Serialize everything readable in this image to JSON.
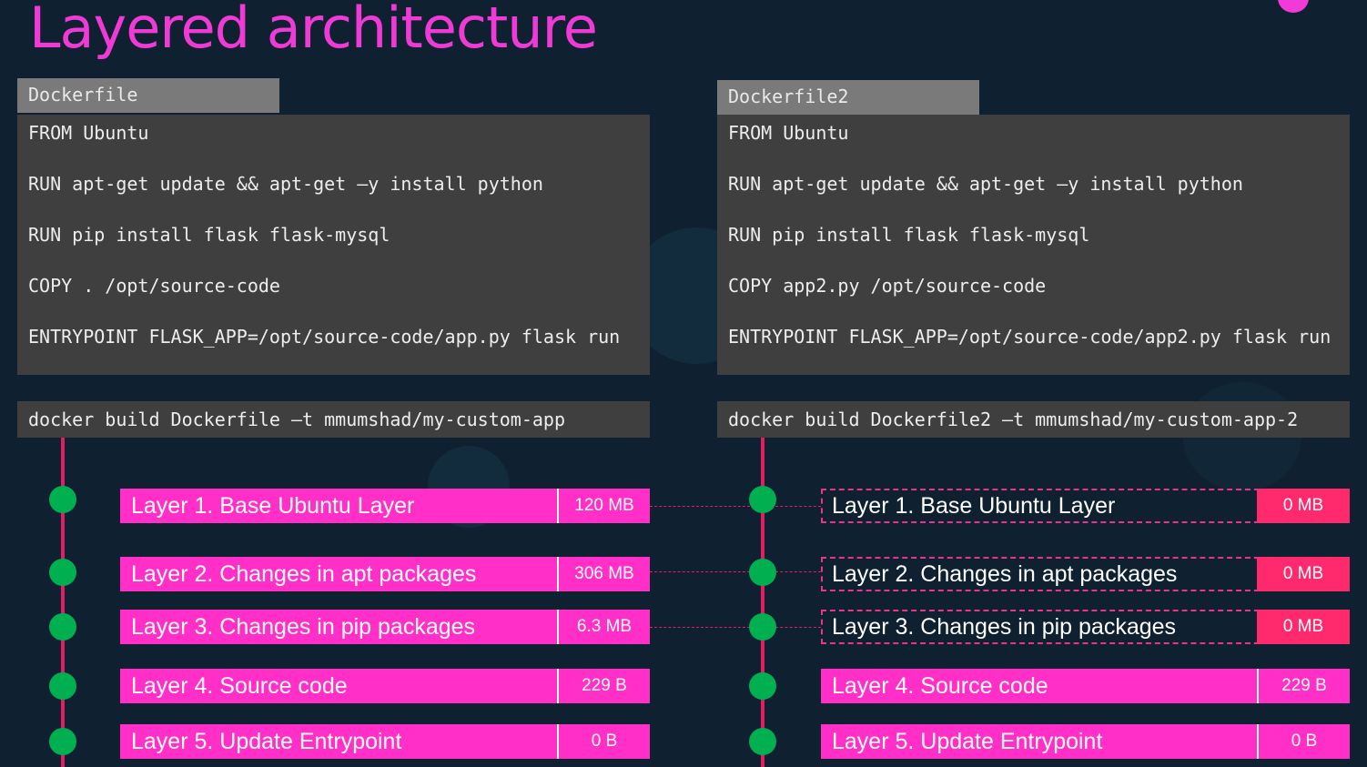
{
  "title": "Layered architecture",
  "left": {
    "tab": "Dockerfile",
    "code": [
      "FROM Ubuntu",
      "RUN apt-get update && apt-get –y install python",
      "RUN pip install flask flask-mysql",
      "COPY . /opt/source-code",
      "ENTRYPOINT FLASK_APP=/opt/source-code/app.py flask run"
    ],
    "command": "docker build Dockerfile –t mmumshad/my-custom-app",
    "layers": [
      {
        "name": "Layer 1. Base Ubuntu Layer",
        "size": "120 MB"
      },
      {
        "name": "Layer 2. Changes in apt packages",
        "size": "306 MB"
      },
      {
        "name": "Layer 3. Changes in pip packages",
        "size": "6.3 MB"
      },
      {
        "name": "Layer 4. Source code",
        "size": "229 B"
      },
      {
        "name": "Layer 5. Update Entrypoint",
        "size": "0 B"
      }
    ]
  },
  "right": {
    "tab": "Dockerfile2",
    "code": [
      "FROM Ubuntu",
      "RUN apt-get update && apt-get –y install python",
      "RUN pip install flask flask-mysql",
      "COPY app2.py /opt/source-code",
      "ENTRYPOINT FLASK_APP=/opt/source-code/app2.py flask run"
    ],
    "command": "docker build Dockerfile2 –t mmumshad/my-custom-app-2",
    "layers": [
      {
        "name": "Layer 1. Base Ubuntu Layer",
        "size": "0 MB"
      },
      {
        "name": "Layer 2. Changes in apt packages",
        "size": "0 MB"
      },
      {
        "name": "Layer 3. Changes in pip packages",
        "size": "0 MB"
      },
      {
        "name": "Layer 4. Source code",
        "size": "229 B"
      },
      {
        "name": "Layer 5. Update Entrypoint",
        "size": "0 B"
      }
    ]
  },
  "colors": {
    "title": "#f03ad6",
    "layer_fill": "#ff2fc7",
    "timeline": "#e11d63",
    "node": "#00b050"
  }
}
